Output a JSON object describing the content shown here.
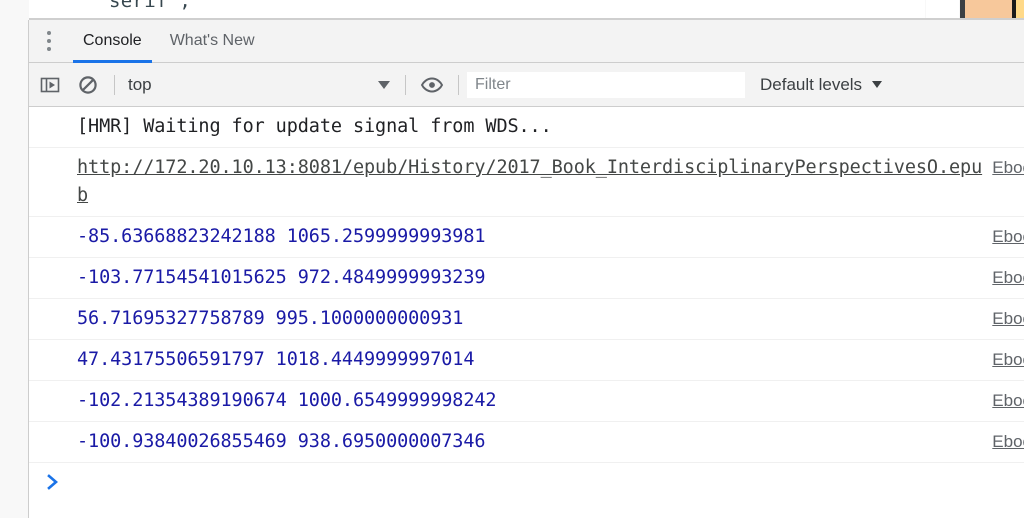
{
  "editor_strip": {
    "code_fragment": "serif\";",
    "swatches": [
      "#3c4043",
      "#f7c89b",
      "#1a1a1a",
      "#ffd988"
    ]
  },
  "drawer": {
    "menu_icon": "kebab-menu-icon",
    "tabs": [
      {
        "label": "Console",
        "active": true
      },
      {
        "label": "What's New",
        "active": false
      }
    ]
  },
  "toolbar": {
    "sidebar_toggle_icon": "console-sidebar-icon",
    "clear_icon": "clear-console-icon",
    "context_selector": {
      "value": "top",
      "caret_icon": "chevron-down-icon"
    },
    "eye_icon": "live-expression-eye-icon",
    "filter": {
      "value": "",
      "placeholder": "Filter"
    },
    "log_levels": {
      "label": "Default levels",
      "caret_icon": "chevron-down-icon"
    }
  },
  "console": {
    "messages": [
      {
        "text": "[HMR] Waiting for update signal from WDS...",
        "kind": "plain",
        "source": ""
      },
      {
        "text": "http://172.20.10.13:8081/epub/History/2017_Book_InterdisciplinaryPerspectivesO.epub",
        "kind": "link",
        "source": "Eboo"
      },
      {
        "text": "-85.63668823242188 1065.2599999993981",
        "kind": "number",
        "source": "Eboo"
      },
      {
        "text": "-103.77154541015625 972.4849999993239",
        "kind": "number",
        "source": "Eboo"
      },
      {
        "text": "56.71695327758789 995.1000000000931",
        "kind": "number",
        "source": "Eboo"
      },
      {
        "text": "47.43175506591797 1018.4449999997014",
        "kind": "number",
        "source": "Eboo"
      },
      {
        "text": "-102.21354389190674 1000.6549999998242",
        "kind": "number",
        "source": "Eboo"
      },
      {
        "text": "-100.93840026855469 938.6950000007346",
        "kind": "number",
        "source": "Eboo"
      }
    ],
    "prompt": {
      "chevron_icon": "prompt-chevron-icon",
      "value": ""
    }
  },
  "colors": {
    "accent": "#1a73e8",
    "number_text": "#1a1aa6",
    "plain_text": "#202124",
    "muted_text": "#5f6368",
    "toolbar_bg": "#f3f3f3",
    "border": "#cdcdcd"
  }
}
